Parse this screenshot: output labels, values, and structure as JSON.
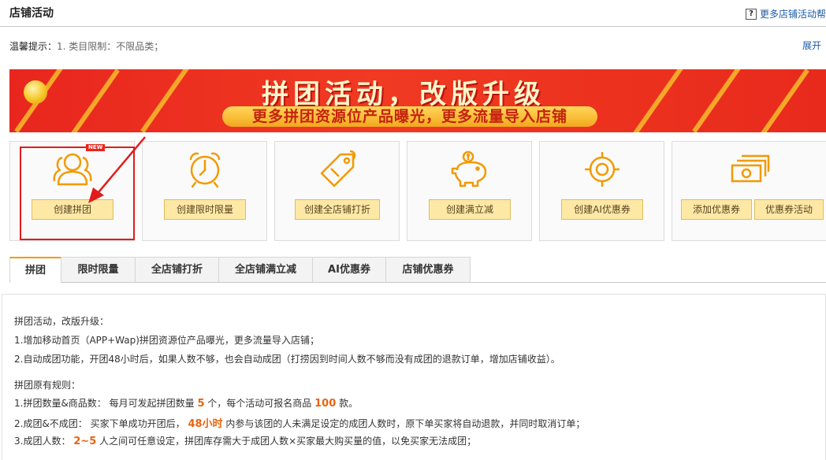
{
  "header": {
    "title": "店铺活动",
    "help_icon": "?",
    "help_link": "更多店铺活动帮",
    "tips_label": "温馨提示：",
    "tips_value": "1. 类目限制：不限品类；",
    "expand": "展开"
  },
  "banner": {
    "headline": "拼团活动，改版升级",
    "subline": "更多拼团资源位产品曝光，更多流量导入店铺"
  },
  "cards": [
    {
      "icon": "group-users-icon",
      "buttons": [
        "创建拼团"
      ],
      "badge": "NEW"
    },
    {
      "icon": "alarm-clock-icon",
      "buttons": [
        "创建限时限量"
      ]
    },
    {
      "icon": "price-tag-icon",
      "buttons": [
        "创建全店铺打折"
      ]
    },
    {
      "icon": "piggy-bank-icon",
      "buttons": [
        "创建满立减"
      ]
    },
    {
      "icon": "target-icon",
      "buttons": [
        "创建AI优惠券"
      ]
    },
    {
      "icon": "money-stack-icon",
      "buttons": [
        "添加优惠券",
        "优惠券活动"
      ]
    }
  ],
  "tabs": [
    "拼团",
    "限时限量",
    "全店铺打折",
    "全店铺满立减",
    "AI优惠券",
    "店铺优惠券"
  ],
  "content": {
    "intro_title": "拼团活动，改版升级：",
    "intro_1": "1.增加移动首页（APP+Wap)拼团资源位产品曝光，更多流量导入店铺；",
    "intro_2": "2.自动成团功能，开团48小时后，如果人数不够，也会自动成团（打捞因到时间人数不够而没有成团的退款订单，增加店铺收益）。",
    "rules_title": "拼团原有规则：",
    "rule1": {
      "a": "1.拼团数量&商品数：  每月可发起拼团数量 ",
      "n1": "5",
      "b": " 个，每个活动可报名商品 ",
      "n2": "100",
      "c": " 款。"
    },
    "rule2": {
      "a": "2.成团&不成团：  买家下单成功开团后，  ",
      "n1": "48小时",
      "b": " 内参与该团的人未满足设定的成团人数时，原下单买家将自动退款，并同时取消订单；"
    },
    "rule3": {
      "a": "3.成团人数：  ",
      "n1": "2~5",
      "b": " 人之间可任意设定，拼团库存需大于成团人数×买家最大购买量的值，以免买家无法成团；"
    }
  },
  "colors": {
    "accent": "#f29a00",
    "icon": "#f29a00",
    "highlight": "#e9630f",
    "link": "#1e5ba8",
    "banner_red": "#e8261e"
  }
}
